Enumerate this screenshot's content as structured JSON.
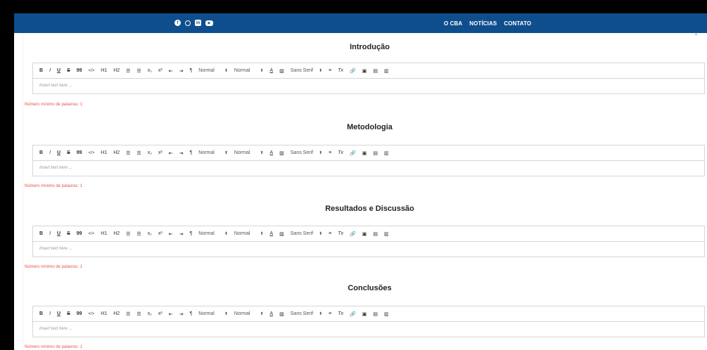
{
  "header": {
    "social": [
      "facebook-icon",
      "instagram-icon",
      "linkedin-icon",
      "youtube-icon"
    ],
    "nav": [
      "O CBA",
      "NOTÍCIAS",
      "CONTATO"
    ],
    "bar_color": "#0f4e8c"
  },
  "toolbar": {
    "bold": "B",
    "italic": "I",
    "underline": "U",
    "strike": "S",
    "blockquote": "99",
    "code": "</>",
    "h1": "H1",
    "h2": "H2",
    "ordered_list": "☰",
    "bullet_list": "☰",
    "subscript": "x₂",
    "superscript": "x²",
    "indent": "⇤",
    "outdent": "⇥",
    "direction": "¶",
    "size_select": "Normal",
    "header_select": "Normal",
    "font_color": "A",
    "background": "▧",
    "font_select": "Sans Serif",
    "align": "≡",
    "clean": "Tx",
    "link": "🔗",
    "image": "▣",
    "video": "▤",
    "formula": "▥"
  },
  "sections": [
    {
      "title": "Introdução",
      "placeholder": "Insert text here ...",
      "min_words": "Número mínimo de palavras: 1"
    },
    {
      "title": "Metodologia",
      "placeholder": "Insert text here ...",
      "min_words": "Número mínimo de palavras: 1"
    },
    {
      "title": "Resultados e Discussão",
      "placeholder": "Insert text here ...",
      "min_words": "Número mínimo de palavras: 1"
    },
    {
      "title": "Conclusões",
      "placeholder": "Insert text here ...",
      "min_words": "Número mínimo de palavras: 1"
    }
  ],
  "colors": {
    "warning": "#e6544f",
    "accent": "#0f4e8c"
  }
}
